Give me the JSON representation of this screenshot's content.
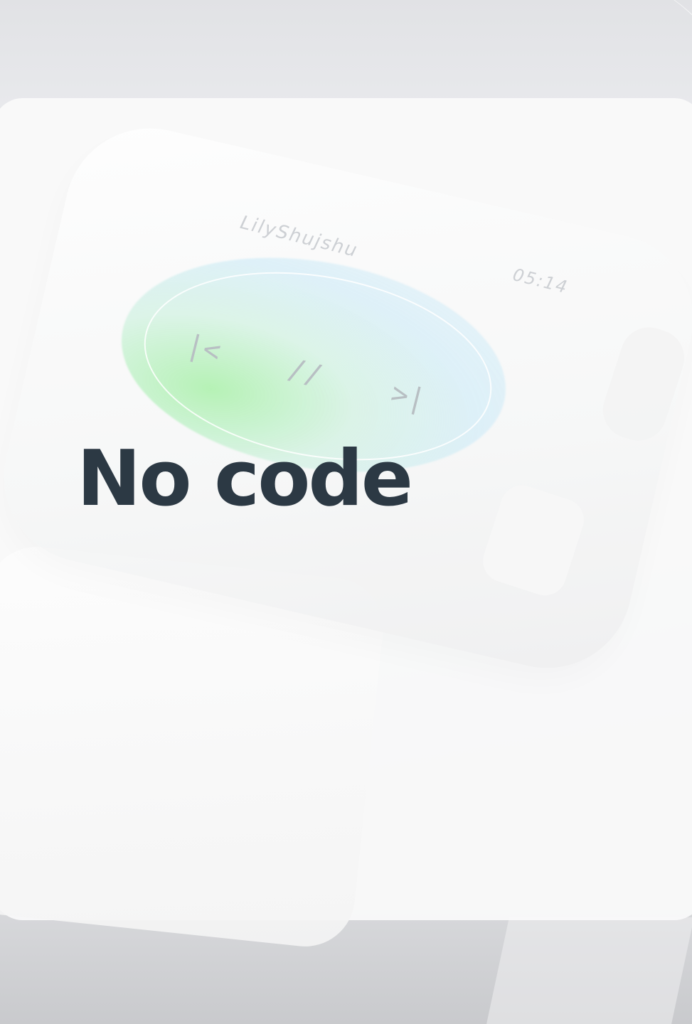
{
  "watch_screen": {
    "artist": "LilyShujshu",
    "time": "05:14",
    "controls": {
      "previous_icon": "previous-track-icon",
      "pause_icon": "pause-icon",
      "next_icon": "next-track-icon",
      "previous_glyph": "|<",
      "pause_glyph": "//",
      "next_glyph": ">|"
    }
  },
  "overlay": {
    "headline": "No code",
    "headline_color": "#2c3944"
  }
}
